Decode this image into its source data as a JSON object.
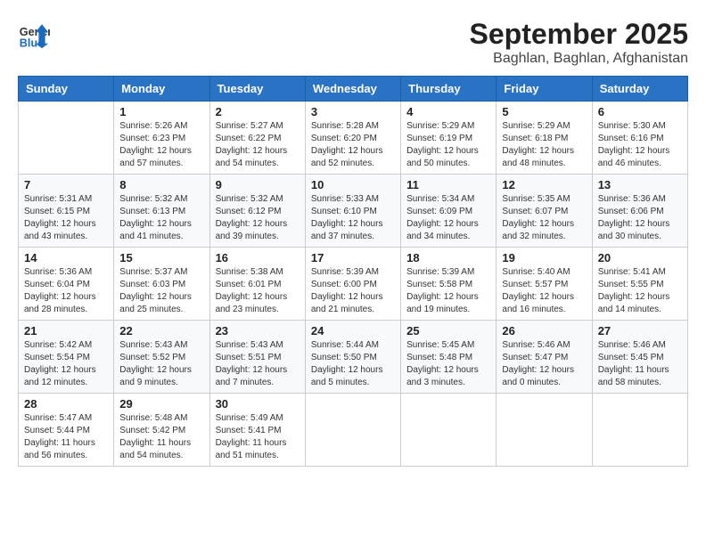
{
  "header": {
    "logo_general": "General",
    "logo_blue": "Blue",
    "month": "September 2025",
    "location": "Baghlan, Baghlan, Afghanistan"
  },
  "weekdays": [
    "Sunday",
    "Monday",
    "Tuesday",
    "Wednesday",
    "Thursday",
    "Friday",
    "Saturday"
  ],
  "weeks": [
    [
      {
        "day": "",
        "info": ""
      },
      {
        "day": "1",
        "info": "Sunrise: 5:26 AM\nSunset: 6:23 PM\nDaylight: 12 hours\nand 57 minutes."
      },
      {
        "day": "2",
        "info": "Sunrise: 5:27 AM\nSunset: 6:22 PM\nDaylight: 12 hours\nand 54 minutes."
      },
      {
        "day": "3",
        "info": "Sunrise: 5:28 AM\nSunset: 6:20 PM\nDaylight: 12 hours\nand 52 minutes."
      },
      {
        "day": "4",
        "info": "Sunrise: 5:29 AM\nSunset: 6:19 PM\nDaylight: 12 hours\nand 50 minutes."
      },
      {
        "day": "5",
        "info": "Sunrise: 5:29 AM\nSunset: 6:18 PM\nDaylight: 12 hours\nand 48 minutes."
      },
      {
        "day": "6",
        "info": "Sunrise: 5:30 AM\nSunset: 6:16 PM\nDaylight: 12 hours\nand 46 minutes."
      }
    ],
    [
      {
        "day": "7",
        "info": "Sunrise: 5:31 AM\nSunset: 6:15 PM\nDaylight: 12 hours\nand 43 minutes."
      },
      {
        "day": "8",
        "info": "Sunrise: 5:32 AM\nSunset: 6:13 PM\nDaylight: 12 hours\nand 41 minutes."
      },
      {
        "day": "9",
        "info": "Sunrise: 5:32 AM\nSunset: 6:12 PM\nDaylight: 12 hours\nand 39 minutes."
      },
      {
        "day": "10",
        "info": "Sunrise: 5:33 AM\nSunset: 6:10 PM\nDaylight: 12 hours\nand 37 minutes."
      },
      {
        "day": "11",
        "info": "Sunrise: 5:34 AM\nSunset: 6:09 PM\nDaylight: 12 hours\nand 34 minutes."
      },
      {
        "day": "12",
        "info": "Sunrise: 5:35 AM\nSunset: 6:07 PM\nDaylight: 12 hours\nand 32 minutes."
      },
      {
        "day": "13",
        "info": "Sunrise: 5:36 AM\nSunset: 6:06 PM\nDaylight: 12 hours\nand 30 minutes."
      }
    ],
    [
      {
        "day": "14",
        "info": "Sunrise: 5:36 AM\nSunset: 6:04 PM\nDaylight: 12 hours\nand 28 minutes."
      },
      {
        "day": "15",
        "info": "Sunrise: 5:37 AM\nSunset: 6:03 PM\nDaylight: 12 hours\nand 25 minutes."
      },
      {
        "day": "16",
        "info": "Sunrise: 5:38 AM\nSunset: 6:01 PM\nDaylight: 12 hours\nand 23 minutes."
      },
      {
        "day": "17",
        "info": "Sunrise: 5:39 AM\nSunset: 6:00 PM\nDaylight: 12 hours\nand 21 minutes."
      },
      {
        "day": "18",
        "info": "Sunrise: 5:39 AM\nSunset: 5:58 PM\nDaylight: 12 hours\nand 19 minutes."
      },
      {
        "day": "19",
        "info": "Sunrise: 5:40 AM\nSunset: 5:57 PM\nDaylight: 12 hours\nand 16 minutes."
      },
      {
        "day": "20",
        "info": "Sunrise: 5:41 AM\nSunset: 5:55 PM\nDaylight: 12 hours\nand 14 minutes."
      }
    ],
    [
      {
        "day": "21",
        "info": "Sunrise: 5:42 AM\nSunset: 5:54 PM\nDaylight: 12 hours\nand 12 minutes."
      },
      {
        "day": "22",
        "info": "Sunrise: 5:43 AM\nSunset: 5:52 PM\nDaylight: 12 hours\nand 9 minutes."
      },
      {
        "day": "23",
        "info": "Sunrise: 5:43 AM\nSunset: 5:51 PM\nDaylight: 12 hours\nand 7 minutes."
      },
      {
        "day": "24",
        "info": "Sunrise: 5:44 AM\nSunset: 5:50 PM\nDaylight: 12 hours\nand 5 minutes."
      },
      {
        "day": "25",
        "info": "Sunrise: 5:45 AM\nSunset: 5:48 PM\nDaylight: 12 hours\nand 3 minutes."
      },
      {
        "day": "26",
        "info": "Sunrise: 5:46 AM\nSunset: 5:47 PM\nDaylight: 12 hours\nand 0 minutes."
      },
      {
        "day": "27",
        "info": "Sunrise: 5:46 AM\nSunset: 5:45 PM\nDaylight: 11 hours\nand 58 minutes."
      }
    ],
    [
      {
        "day": "28",
        "info": "Sunrise: 5:47 AM\nSunset: 5:44 PM\nDaylight: 11 hours\nand 56 minutes."
      },
      {
        "day": "29",
        "info": "Sunrise: 5:48 AM\nSunset: 5:42 PM\nDaylight: 11 hours\nand 54 minutes."
      },
      {
        "day": "30",
        "info": "Sunrise: 5:49 AM\nSunset: 5:41 PM\nDaylight: 11 hours\nand 51 minutes."
      },
      {
        "day": "",
        "info": ""
      },
      {
        "day": "",
        "info": ""
      },
      {
        "day": "",
        "info": ""
      },
      {
        "day": "",
        "info": ""
      }
    ]
  ]
}
